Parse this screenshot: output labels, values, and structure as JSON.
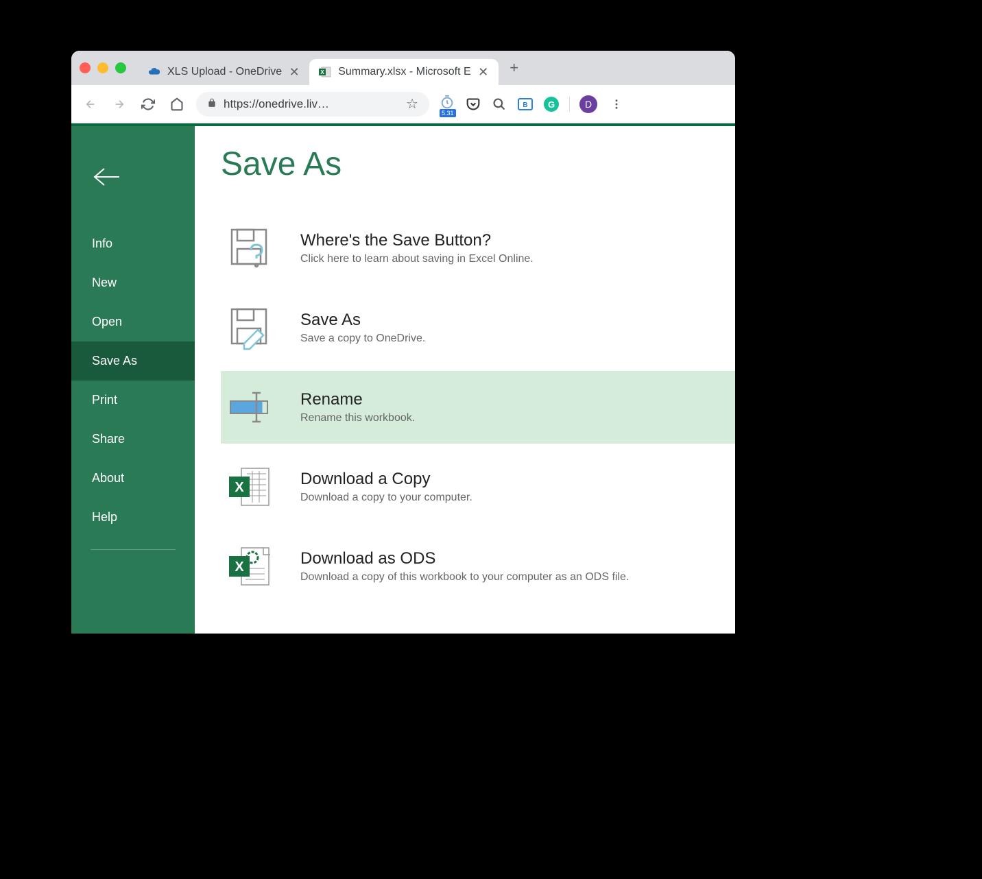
{
  "browser": {
    "tabs": [
      {
        "label": "XLS Upload - OneDrive",
        "active": false
      },
      {
        "label": "Summary.xlsx - Microsoft E",
        "active": true
      }
    ],
    "url": "https://onedrive.liv…",
    "profile_initial": "D",
    "ext_badge": "5.31"
  },
  "page": {
    "title": "Save As",
    "sidebar": {
      "items": [
        {
          "label": "Info"
        },
        {
          "label": "New"
        },
        {
          "label": "Open"
        },
        {
          "label": "Save As",
          "active": true
        },
        {
          "label": "Print"
        },
        {
          "label": "Share"
        },
        {
          "label": "About"
        },
        {
          "label": "Help"
        }
      ]
    },
    "options": [
      {
        "title": "Where's the Save Button?",
        "desc": "Click here to learn about saving in Excel Online."
      },
      {
        "title": "Save As",
        "desc": "Save a copy to OneDrive."
      },
      {
        "title": "Rename",
        "desc": "Rename this workbook.",
        "selected": true
      },
      {
        "title": "Download a Copy",
        "desc": "Download a copy to your computer."
      },
      {
        "title": "Download as ODS",
        "desc": "Download a copy of this workbook to your computer as an ODS file."
      }
    ]
  }
}
